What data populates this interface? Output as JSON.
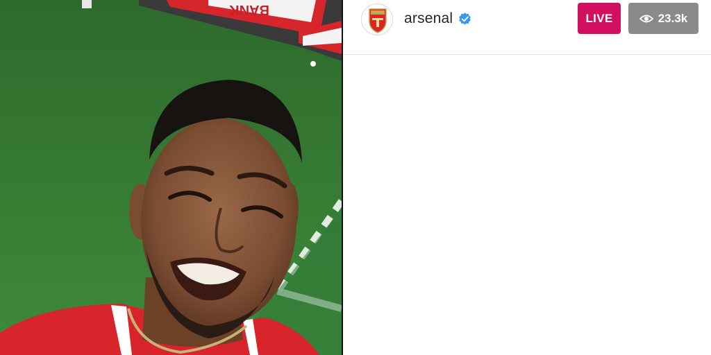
{
  "header": {
    "username": "arsenal",
    "verified": true,
    "avatar_icon": "arsenal-crest-icon",
    "live_label": "LIVE",
    "viewer_count": "23.3k",
    "viewer_icon": "eye-icon"
  },
  "stream": {
    "ad_board_text": "BANK"
  },
  "colors": {
    "live_badge": "#d1105f",
    "viewer_badge": "#8a8a8a",
    "verified": "#3897f0",
    "pitch_green": "#3a7d38",
    "kit_red": "#d8242b"
  }
}
